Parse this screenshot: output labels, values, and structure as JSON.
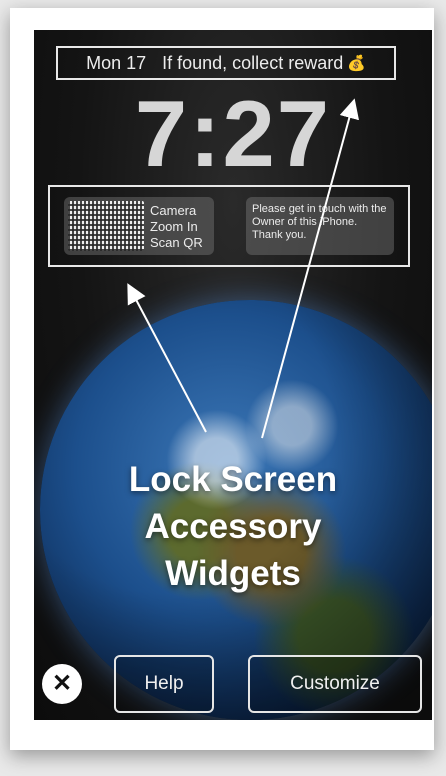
{
  "lockscreen": {
    "date_text": "Mon 17",
    "reward_text": "If found, collect reward",
    "money_icon": "💰",
    "time": "7:27"
  },
  "widgets": {
    "qr_label_lines": [
      "Camera",
      "Zoom In",
      "Scan QR"
    ],
    "message": "Please get in touch with the Owner of this iPhone. Thank you."
  },
  "headline_lines": [
    "Lock Screen",
    "Accessory",
    "Widgets"
  ],
  "buttons": {
    "close_icon": "close-icon",
    "help_label": "Help",
    "customize_label": "Customize"
  }
}
